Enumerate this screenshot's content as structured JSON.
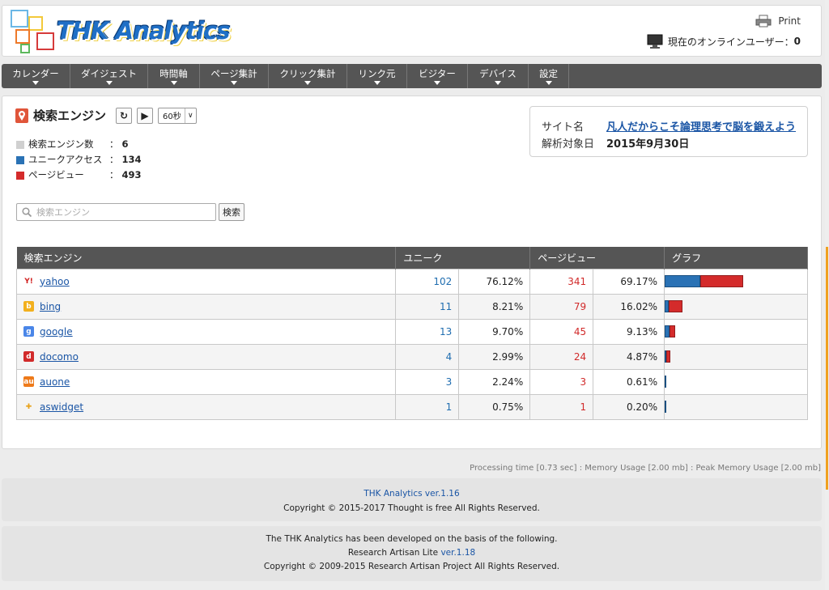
{
  "header": {
    "logo_text": "THK Analytics",
    "print_label": "Print",
    "online_label": "現在のオンラインユーザー：",
    "online_count": "0"
  },
  "nav": [
    {
      "label": "カレンダー"
    },
    {
      "label": "ダイジェスト"
    },
    {
      "label": "時間軸"
    },
    {
      "label": "ページ集計"
    },
    {
      "label": "クリック集計"
    },
    {
      "label": "リンク元"
    },
    {
      "label": "ビジター"
    },
    {
      "label": "デバイス"
    },
    {
      "label": "設定"
    }
  ],
  "page": {
    "title": "検索エンジン",
    "interval": "60秒",
    "stats": [
      {
        "label": "検索エンジン数",
        "value": "6",
        "color": "#d0d0d0"
      },
      {
        "label": "ユニークアクセス",
        "value": "134",
        "color": "#2a72b5"
      },
      {
        "label": "ページビュー",
        "value": "493",
        "color": "#d42b2b"
      }
    ]
  },
  "site": {
    "name_label": "サイト名",
    "name_value": "凡人だからこそ論理思考で脳を鍛えよう",
    "date_label": "解析対象日",
    "date_value": "2015年9月30日"
  },
  "search": {
    "placeholder": "検索エンジン",
    "button": "検索"
  },
  "table": {
    "headers": [
      "検索エンジン",
      "ユニーク",
      "ページビュー",
      "グラフ"
    ],
    "rows": [
      {
        "name": "yahoo",
        "icon": "yahoo-icon",
        "uniq": "102",
        "uniq_pct": "76.12%",
        "pv": "341",
        "pv_pct": "69.17%"
      },
      {
        "name": "bing",
        "icon": "bing-icon",
        "uniq": "11",
        "uniq_pct": "8.21%",
        "pv": "79",
        "pv_pct": "16.02%"
      },
      {
        "name": "google",
        "icon": "google-icon",
        "uniq": "13",
        "uniq_pct": "9.70%",
        "pv": "45",
        "pv_pct": "9.13%"
      },
      {
        "name": "docomo",
        "icon": "docomo-icon",
        "uniq": "4",
        "uniq_pct": "2.99%",
        "pv": "24",
        "pv_pct": "4.87%"
      },
      {
        "name": "auone",
        "icon": "auone-icon",
        "uniq": "3",
        "uniq_pct": "2.24%",
        "pv": "3",
        "pv_pct": "0.61%"
      },
      {
        "name": "aswidget",
        "icon": "aswidget-icon",
        "uniq": "1",
        "uniq_pct": "0.75%",
        "pv": "1",
        "pv_pct": "0.20%"
      }
    ]
  },
  "footer": {
    "processing": "Processing time [0.73 sec] : Memory Usage [2.00 mb] : Peak Memory Usage [2.00 mb]",
    "product_prefix": "THK Analytics ",
    "product_version": "ver.1.16",
    "copyright1": "Copyright © 2015-2017 Thought is free All Rights Reserved.",
    "based_on": "The THK Analytics has been developed on the basis of the following.",
    "ra_prefix": "Research Artisan Lite ",
    "ra_version": "ver.1.18",
    "copyright2": "Copyright © 2009-2015 Research Artisan Project All Rights Reserved."
  }
}
